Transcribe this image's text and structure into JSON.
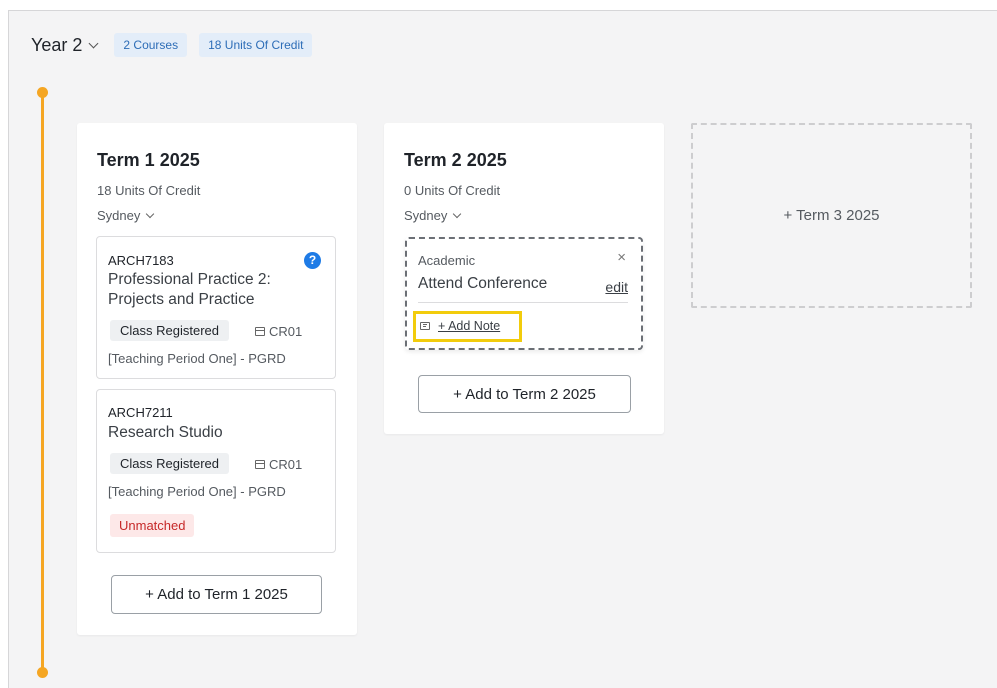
{
  "year": {
    "title": "Year 2",
    "courses_tag": "2 Courses",
    "credits_tag": "18 Units Of Credit"
  },
  "terms": [
    {
      "title": "Term 1 2025",
      "credits": "18 Units Of Credit",
      "location": "Sydney",
      "courses": [
        {
          "code": "ARCH7183",
          "name_line1": "Professional Practice 2:",
          "name_line2": "Projects and Practice",
          "status": "Class Registered",
          "class_code": "CR01",
          "period": "[Teaching Period One] - PGRD",
          "help_icon": "?"
        },
        {
          "code": "ARCH7211",
          "name_line1": "Research Studio",
          "status": "Class Registered",
          "class_code": "CR01",
          "period": "[Teaching Period One] - PGRD",
          "warning": "Unmatched"
        }
      ],
      "add_label": "+ Add to Term 1 2025"
    },
    {
      "title": "Term 2 2025",
      "credits": "0 Units Of Credit",
      "location": "Sydney",
      "event": {
        "type": "Academic",
        "title": "Attend Conference",
        "edit_label": "edit",
        "close_glyph": "×",
        "add_note_label": "+ Add Note"
      },
      "add_label": "+ Add to Term 2 2025"
    },
    {
      "add_label": "+ Term 3 2025"
    }
  ],
  "colors": {
    "timeline": "#f5a623",
    "tag_bg": "#e3edf9",
    "tag_text": "#2d6db7",
    "highlight": "#f2cc0c",
    "unmatched_bg": "#fde8e8",
    "unmatched_text": "#c62828",
    "help_icon": "#1e7be6"
  },
  "icons": [
    "chevron-down-icon",
    "help-circle-icon",
    "calendar-icon",
    "close-icon",
    "note-icon"
  ]
}
